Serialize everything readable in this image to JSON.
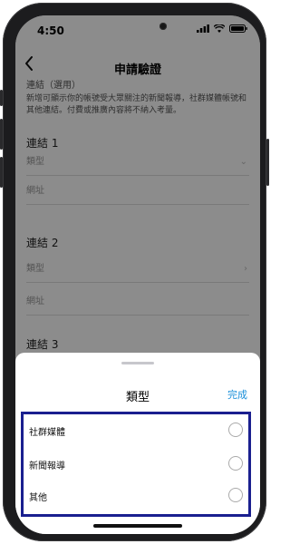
{
  "status_bar": {
    "time": "4:50"
  },
  "navbar": {
    "title": "申請驗證"
  },
  "content": {
    "section_header": "連結（選用）",
    "description": "新增可顯示你的帳號受大眾關注的新聞報導，社群媒體帳號和其他連結。付費或推廣內容將不納入考量。",
    "links": [
      {
        "title": "連結 1",
        "type_placeholder": "類型",
        "url_placeholder": "網址"
      },
      {
        "title": "連結 2",
        "type_placeholder": "類型",
        "url_placeholder": "網址"
      },
      {
        "title": "連結 3"
      }
    ]
  },
  "sheet": {
    "title": "類型",
    "done_label": "完成",
    "options": [
      {
        "label": "社群媒體",
        "selected": false
      },
      {
        "label": "新聞報導",
        "selected": false
      },
      {
        "label": "其他",
        "selected": false
      }
    ]
  },
  "colors": {
    "accent": "#1a8fd9",
    "highlight_border": "#1a1f8f"
  },
  "icons": {
    "back": "chevron-left-icon",
    "signal": "signal-icon",
    "wifi": "wifi-icon",
    "battery": "battery-icon"
  }
}
